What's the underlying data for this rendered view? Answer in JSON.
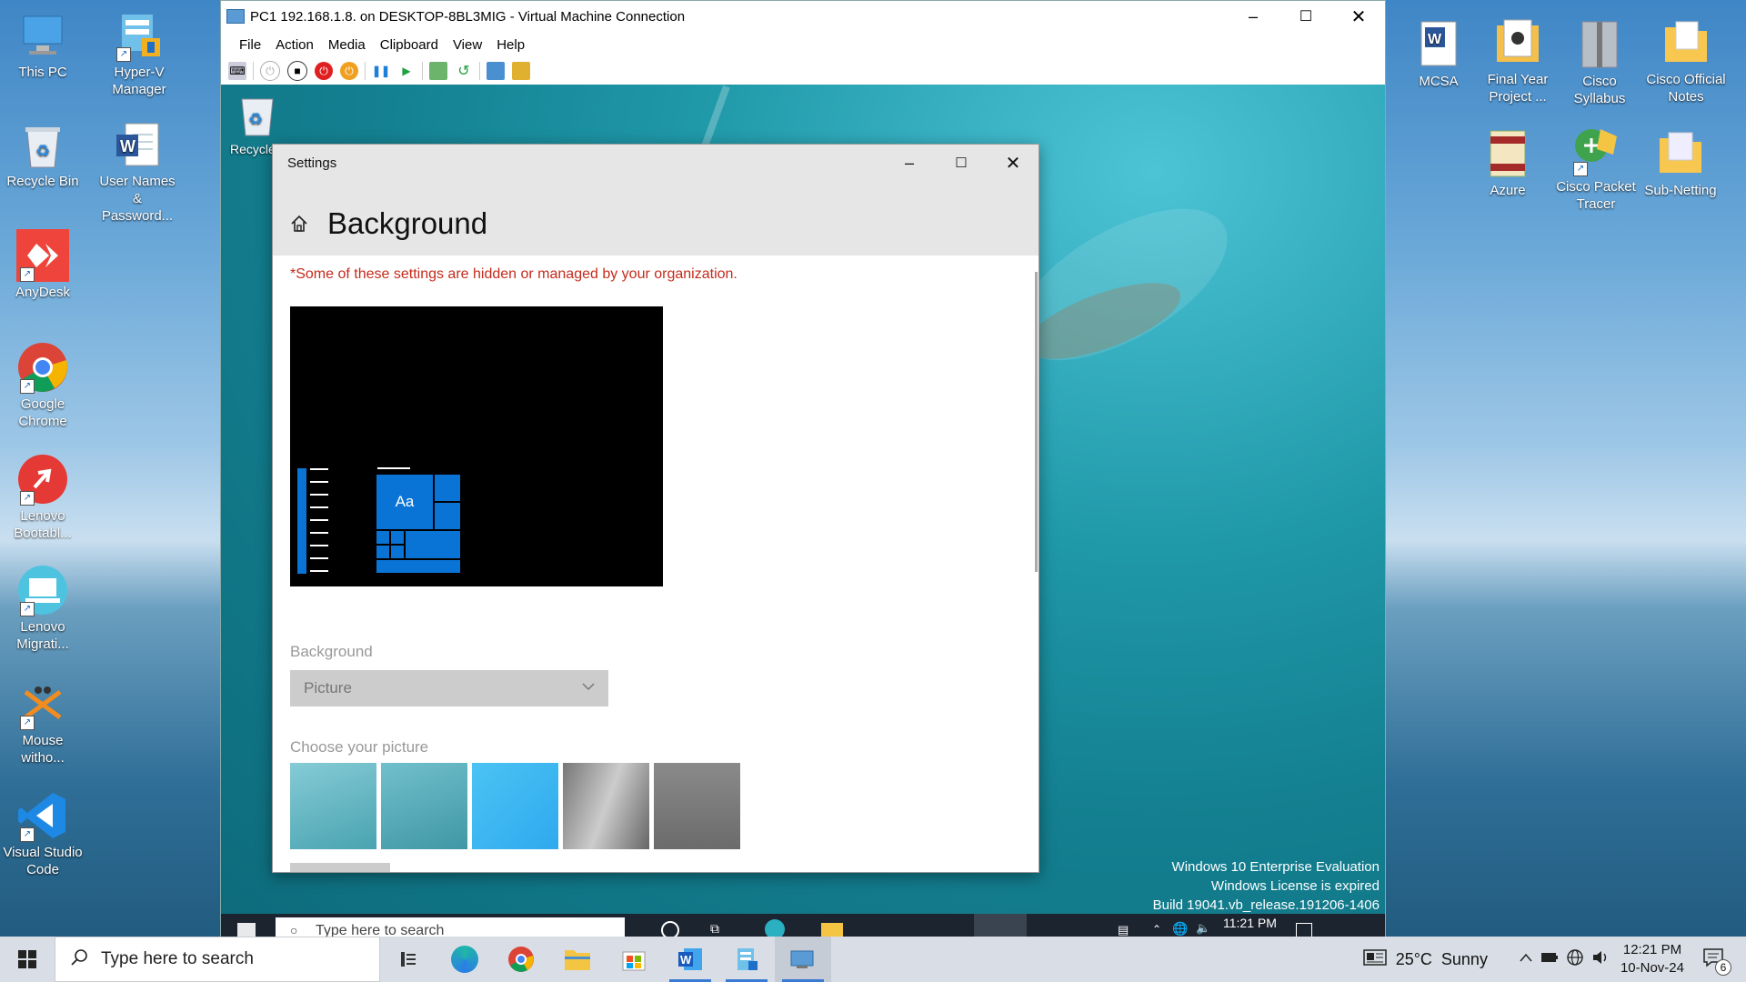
{
  "host_desktop_left": [
    {
      "name": "This PC",
      "icon": "monitor-icon"
    },
    {
      "name": "Hyper-V Manager",
      "icon": "hyperv-icon"
    },
    {
      "name": "Recycle Bin",
      "icon": "recycle-bin-icon"
    },
    {
      "name": "User Names & Password...",
      "icon": "word-doc-icon"
    },
    {
      "name": "AnyDesk",
      "icon": "anydesk-icon"
    },
    {
      "name": "Google Chrome",
      "icon": "chrome-icon"
    },
    {
      "name": "Lenovo Bootabl...",
      "icon": "lenovo-boot-icon"
    },
    {
      "name": "Lenovo Migrati...",
      "icon": "lenovo-migrate-icon"
    },
    {
      "name": "Mouse witho...",
      "icon": "mouse-icon"
    },
    {
      "name": "Visual Studio Code",
      "icon": "vscode-icon"
    }
  ],
  "host_desktop_right": [
    {
      "name": "MCSA",
      "icon": "word-doc-icon"
    },
    {
      "name": "Final Year Project ...",
      "icon": "doc-icon"
    },
    {
      "name": "Cisco Syllabus",
      "icon": "zip-folder-icon"
    },
    {
      "name": "Cisco Official Notes",
      "icon": "folder-icon"
    },
    {
      "name": "Azure",
      "icon": "book-icon"
    },
    {
      "name": "Cisco Packet Tracer",
      "icon": "packet-tracer-icon"
    },
    {
      "name": "Sub-Netting",
      "icon": "folder-icon"
    }
  ],
  "vm": {
    "title": "PC1 192.168.1.8. on DESKTOP-8BL3MIG - Virtual Machine Connection",
    "menu": [
      "File",
      "Action",
      "Media",
      "Clipboard",
      "View",
      "Help"
    ],
    "guest_icons": [
      {
        "name": "Recycle",
        "icon": "recycle-bin-icon"
      }
    ],
    "watermark": [
      "Windows 10 Enterprise Evaluation",
      "Windows License is expired",
      "Build 19041.vb_release.191206-1406"
    ],
    "taskbar": {
      "search_placeholder": "Type here to search",
      "time": "11:21 PM"
    }
  },
  "settings": {
    "window_title": "Settings",
    "page_title": "Background",
    "org_notice": "*Some of these settings are hidden or managed by your organization.",
    "preview_tile_text": "Aa",
    "background_label": "Background",
    "background_value": "Picture",
    "choose_picture_label": "Choose your picture"
  },
  "taskbar": {
    "search_placeholder": "Type here to search",
    "weather": "25°C  Sunny",
    "time": "12:21 PM",
    "date": "10-Nov-24",
    "notification_count": "6"
  },
  "colors": {
    "org_notice": "#c42b1c",
    "accent": "#0078d7"
  }
}
